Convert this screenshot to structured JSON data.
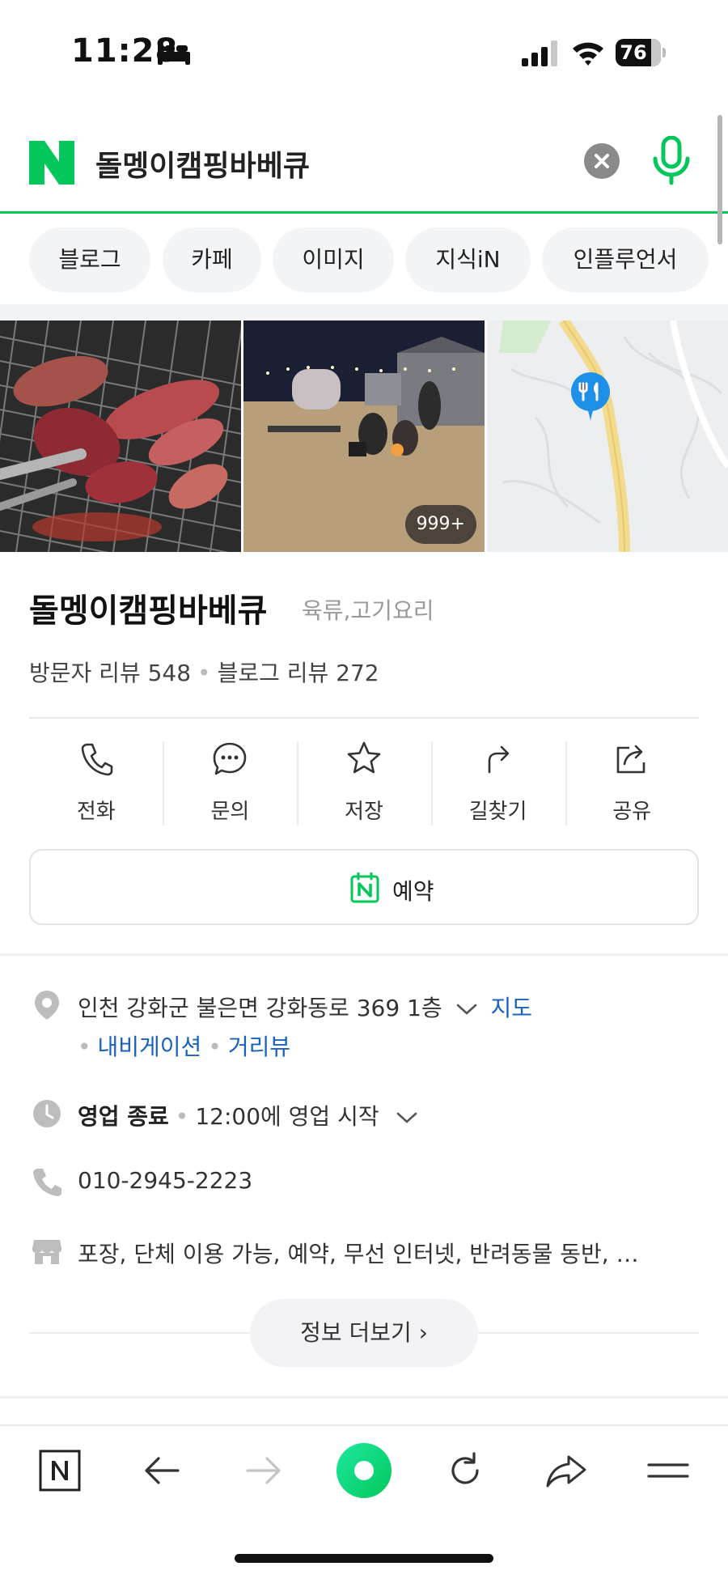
{
  "status_bar": {
    "time": "11:28",
    "battery": "76"
  },
  "search": {
    "query": "돌멩이캠핑바베큐"
  },
  "tabs": [
    {
      "label": "블로그"
    },
    {
      "label": "카페"
    },
    {
      "label": "이미지"
    },
    {
      "label": "지식iN"
    },
    {
      "label": "인플루언서"
    }
  ],
  "photos": {
    "count_badge": "999+"
  },
  "place": {
    "name": "돌멩이캠핑바베큐",
    "category": "육류,고기요리",
    "visitor_reviews": "방문자 리뷰 548",
    "blog_reviews": "블로그 리뷰 272"
  },
  "actions": [
    {
      "label": "전화"
    },
    {
      "label": "문의"
    },
    {
      "label": "저장"
    },
    {
      "label": "길찾기"
    },
    {
      "label": "공유"
    }
  ],
  "reserve": {
    "label": "예약"
  },
  "details": {
    "address": "인천 강화군 불은면 강화동로 369 1층",
    "map_link": "지도",
    "nav_link": "내비게이션",
    "street_view_link": "거리뷰",
    "hours_status": "영업 종료",
    "hours_next": "12:00에 영업 시작",
    "phone": "010-2945-2223",
    "amenities": "포장, 단체 이용 가능, 예약, 무선 인터넷, 반려동물 동반, …",
    "more_button": "정보 더보기 ›"
  },
  "colors": {
    "brand_green": "#03c75a",
    "link_blue": "#1a62c0",
    "pin_blue": "#1e90e8"
  }
}
